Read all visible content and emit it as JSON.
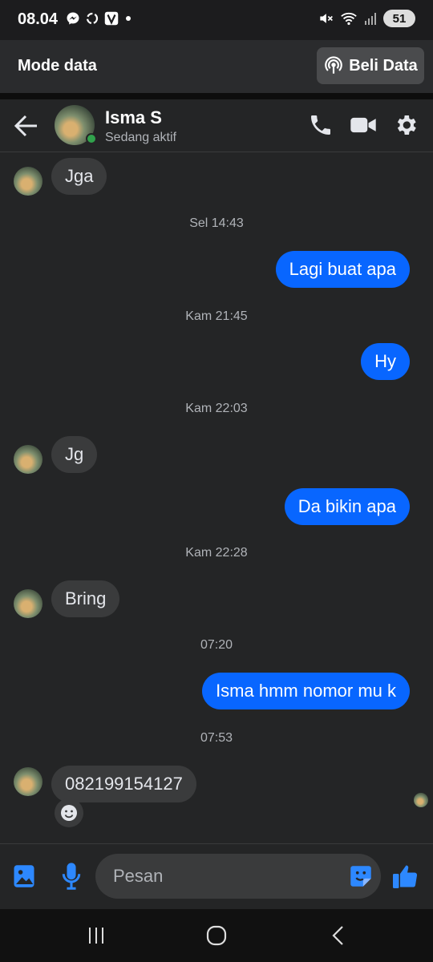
{
  "status_bar": {
    "time": "08.04",
    "battery": "51",
    "icons": [
      "messenger-icon",
      "sync-icon",
      "v-app-icon",
      "dot-icon",
      "mute-icon",
      "wifi-icon",
      "signal-icon",
      "battery-icon"
    ]
  },
  "data_bar": {
    "title": "Mode data",
    "buy_label": "Beli Data"
  },
  "chat_header": {
    "name": "Isma S",
    "status": "Sedang aktif",
    "icons": [
      "back-arrow-icon",
      "phone-icon",
      "video-icon",
      "gear-icon"
    ]
  },
  "messages": [
    {
      "kind": "in",
      "text": "Jga"
    },
    {
      "kind": "time",
      "text": "Sel 14:43"
    },
    {
      "kind": "out",
      "text": "Lagi buat apa"
    },
    {
      "kind": "time",
      "text": "Kam 21:45"
    },
    {
      "kind": "out",
      "text": "Hy"
    },
    {
      "kind": "time",
      "text": "Kam 22:03"
    },
    {
      "kind": "in",
      "text": "Jg"
    },
    {
      "kind": "out",
      "text": "Da bikin apa"
    },
    {
      "kind": "time",
      "text": "Kam 22:28"
    },
    {
      "kind": "in",
      "text": "Bring"
    },
    {
      "kind": "time",
      "text": "07:20"
    },
    {
      "kind": "out",
      "text": "Isma hmm nomor mu k"
    },
    {
      "kind": "time",
      "text": "07:53"
    },
    {
      "kind": "in",
      "text": "082199154127"
    }
  ],
  "composer": {
    "placeholder": "Pesan",
    "icons": [
      "image-icon",
      "mic-icon",
      "sticker-icon",
      "like-icon"
    ]
  },
  "nav": {
    "icons": [
      "recents-icon",
      "home-icon",
      "back-icon"
    ]
  },
  "colors": {
    "background": "#242526",
    "outgoing_bubble": "#0866ff",
    "incoming_bubble": "#3a3b3c",
    "accent": "#2d88ff",
    "online": "#31a24c"
  }
}
